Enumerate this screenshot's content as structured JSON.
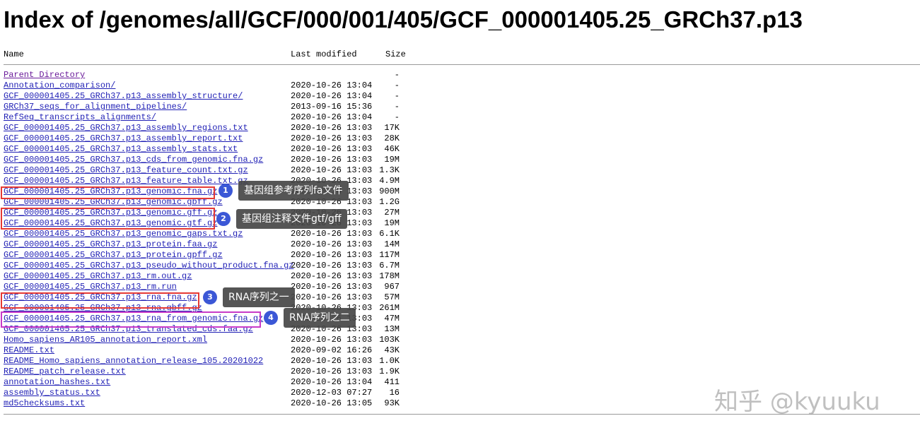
{
  "page": {
    "title": "Index of /genomes/all/GCF/000/001/405/GCF_000001405.25_GRCh37.p13"
  },
  "columns": {
    "name": "Name",
    "last_modified": "Last modified",
    "size": "Size"
  },
  "entries": [
    {
      "name": "Parent Directory",
      "modified": "",
      "size": "-"
    },
    {
      "name": "Annotation_comparison/",
      "modified": "2020-10-26 13:04",
      "size": "-"
    },
    {
      "name": "GCF_000001405.25_GRCh37.p13_assembly_structure/",
      "modified": "2020-10-26 13:04",
      "size": "-"
    },
    {
      "name": "GRCh37_seqs_for_alignment_pipelines/",
      "modified": "2013-09-16 15:36",
      "size": "-"
    },
    {
      "name": "RefSeq_transcripts_alignments/",
      "modified": "2020-10-26 13:04",
      "size": "-"
    },
    {
      "name": "GCF_000001405.25_GRCh37.p13_assembly_regions.txt",
      "modified": "2020-10-26 13:03",
      "size": "17K"
    },
    {
      "name": "GCF_000001405.25_GRCh37.p13_assembly_report.txt",
      "modified": "2020-10-26 13:03",
      "size": "28K"
    },
    {
      "name": "GCF_000001405.25_GRCh37.p13_assembly_stats.txt",
      "modified": "2020-10-26 13:03",
      "size": "46K"
    },
    {
      "name": "GCF_000001405.25_GRCh37.p13_cds_from_genomic.fna.gz",
      "modified": "2020-10-26 13:03",
      "size": "19M"
    },
    {
      "name": "GCF_000001405.25_GRCh37.p13_feature_count.txt.gz",
      "modified": "2020-10-26 13:03",
      "size": "1.3K"
    },
    {
      "name": "GCF_000001405.25_GRCh37.p13_feature_table.txt.gz",
      "modified": "2020-10-26 13:03",
      "size": "4.9M"
    },
    {
      "name": "GCF_000001405.25_GRCh37.p13_genomic.fna.gz",
      "modified": "2020-10-26 13:03",
      "size": "900M"
    },
    {
      "name": "GCF_000001405.25_GRCh37.p13_genomic.gbff.gz",
      "modified": "2020-10-26 13:03",
      "size": "1.2G"
    },
    {
      "name": "GCF_000001405.25_GRCh37.p13_genomic.gff.gz",
      "modified": "2020-10-26 13:03",
      "size": "27M"
    },
    {
      "name": "GCF_000001405.25_GRCh37.p13_genomic.gtf.gz",
      "modified": "2020-10-26 13:03",
      "size": "19M"
    },
    {
      "name": "GCF_000001405.25_GRCh37.p13_genomic_gaps.txt.gz",
      "modified": "2020-10-26 13:03",
      "size": "6.1K"
    },
    {
      "name": "GCF_000001405.25_GRCh37.p13_protein.faa.gz",
      "modified": "2020-10-26 13:03",
      "size": "14M"
    },
    {
      "name": "GCF_000001405.25_GRCh37.p13_protein.gpff.gz",
      "modified": "2020-10-26 13:03",
      "size": "117M"
    },
    {
      "name": "GCF_000001405.25_GRCh37.p13_pseudo_without_product.fna.gz",
      "modified": "2020-10-26 13:03",
      "size": "6.7M"
    },
    {
      "name": "GCF_000001405.25_GRCh37.p13_rm.out.gz",
      "modified": "2020-10-26 13:03",
      "size": "178M"
    },
    {
      "name": "GCF_000001405.25_GRCh37.p13_rm.run",
      "modified": "2020-10-26 13:03",
      "size": "967"
    },
    {
      "name": "GCF_000001405.25_GRCh37.p13_rna.fna.gz",
      "modified": "2020-10-26 13:03",
      "size": "57M"
    },
    {
      "name": "GCF_000001405.25_GRCh37.p13_rna.gbff.gz",
      "modified": "2020-10-26 13:03",
      "size": "261M"
    },
    {
      "name": "GCF_000001405.25_GRCh37.p13_rna_from_genomic.fna.gz",
      "modified": "2020-10-26 13:03",
      "size": "47M"
    },
    {
      "name": "GCF_000001405.25_GRCh37.p13_translated_cds.faa.gz",
      "modified": "2020-10-26 13:03",
      "size": "13M"
    },
    {
      "name": "Homo_sapiens_AR105_annotation_report.xml",
      "modified": "2020-10-26 13:03",
      "size": "103K"
    },
    {
      "name": "README.txt",
      "modified": "2020-09-02 16:26",
      "size": "43K"
    },
    {
      "name": "README_Homo_sapiens_annotation_release_105.20201022",
      "modified": "2020-10-26 13:03",
      "size": "1.0K"
    },
    {
      "name": "README_patch_release.txt",
      "modified": "2020-10-26 13:03",
      "size": "1.9K"
    },
    {
      "name": "annotation_hashes.txt",
      "modified": "2020-10-26 13:04",
      "size": "411"
    },
    {
      "name": "assembly_status.txt",
      "modified": "2020-12-03 07:27",
      "size": "16"
    },
    {
      "name": "md5checksums.txt",
      "modified": "2020-10-26 13:05",
      "size": "93K"
    }
  ],
  "annotations": [
    {
      "number": "1",
      "label": "基因组参考序列fa文件"
    },
    {
      "number": "2",
      "label": "基因组注释文件gtf/gff"
    },
    {
      "number": "3",
      "label": "RNA序列之一"
    },
    {
      "number": "4",
      "label": "RNA序列之二"
    }
  ],
  "watermark": "知乎 @kyuuku",
  "colors": {
    "link": "#1f1fb5",
    "visited_link": "#6a1b9a",
    "highlight_red": "#e53935",
    "highlight_purple": "#c83bc8",
    "badge": "#3b57d6"
  }
}
